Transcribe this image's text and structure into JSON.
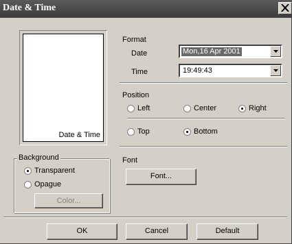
{
  "window": {
    "title": "Date & Time"
  },
  "preview": {
    "text": "Date & Time"
  },
  "format": {
    "heading": "Format",
    "date_label": "Date",
    "date_value": "Mon,16 Apr 2001",
    "time_label": "Time",
    "time_value": "19:49:43"
  },
  "position": {
    "heading": "Position",
    "horizontal": [
      {
        "label": "Left",
        "selected": false
      },
      {
        "label": "Center",
        "selected": false
      },
      {
        "label": "Right",
        "selected": true
      }
    ],
    "vertical": [
      {
        "label": "Top",
        "selected": false
      },
      {
        "label": "Bottom",
        "selected": true
      }
    ]
  },
  "background": {
    "legend": "Background",
    "options": [
      {
        "label": "Transparent",
        "selected": true
      },
      {
        "label": "Opague",
        "selected": false
      }
    ],
    "color_button": "Color..."
  },
  "font": {
    "heading": "Font",
    "button": "Font..."
  },
  "buttons": {
    "ok": "OK",
    "cancel": "Cancel",
    "default": "Default"
  }
}
